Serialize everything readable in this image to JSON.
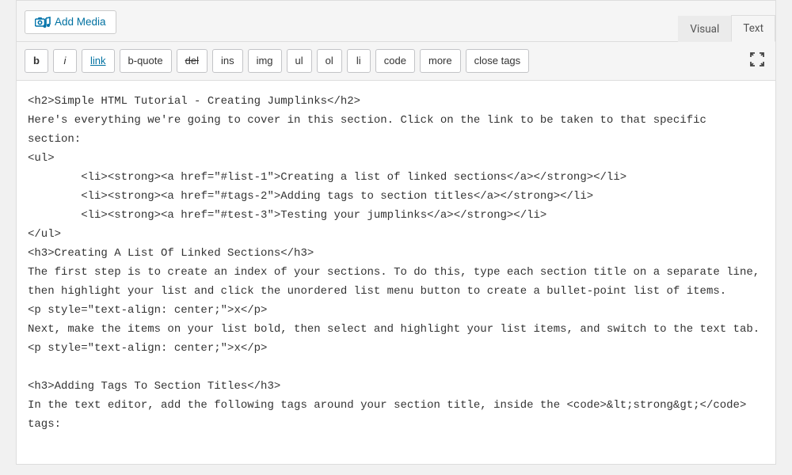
{
  "toolbar": {
    "add_media_label": "Add Media"
  },
  "tabs": {
    "visual": "Visual",
    "text": "Text",
    "active": "text"
  },
  "quicktags": {
    "b": "b",
    "i": "i",
    "link": "link",
    "bquote": "b-quote",
    "del": "del",
    "ins": "ins",
    "img": "img",
    "ul": "ul",
    "ol": "ol",
    "li": "li",
    "code": "code",
    "more": "more",
    "close": "close tags"
  },
  "editor": {
    "content": "<h2>Simple HTML Tutorial - Creating Jumplinks</h2>\nHere's everything we're going to cover in this section. Click on the link to be taken to that specific section:\n<ul>\n \t<li><strong><a href=\"#list-1\">Creating a list of linked sections</a></strong></li>\n \t<li><strong><a href=\"#tags-2\">Adding tags to section titles</a></strong></li>\n \t<li><strong><a href=\"#test-3\">Testing your jumplinks</a></strong></li>\n</ul>\n<h3>Creating A List Of Linked Sections</h3>\nThe first step is to create an index of your sections. To do this, type each section title on a separate line, then highlight your list and click the unordered list menu button to create a bullet-point list of items.\n<p style=\"text-align: center;\">x</p>\nNext, make the items on your list bold, then select and highlight your list items, and switch to the text tab.\n<p style=\"text-align: center;\">x</p>\n\n<h3>Adding Tags To Section Titles</h3>\nIn the text editor, add the following tags around your section title, inside the <code>&lt;strong&gt;</code> tags:"
  }
}
